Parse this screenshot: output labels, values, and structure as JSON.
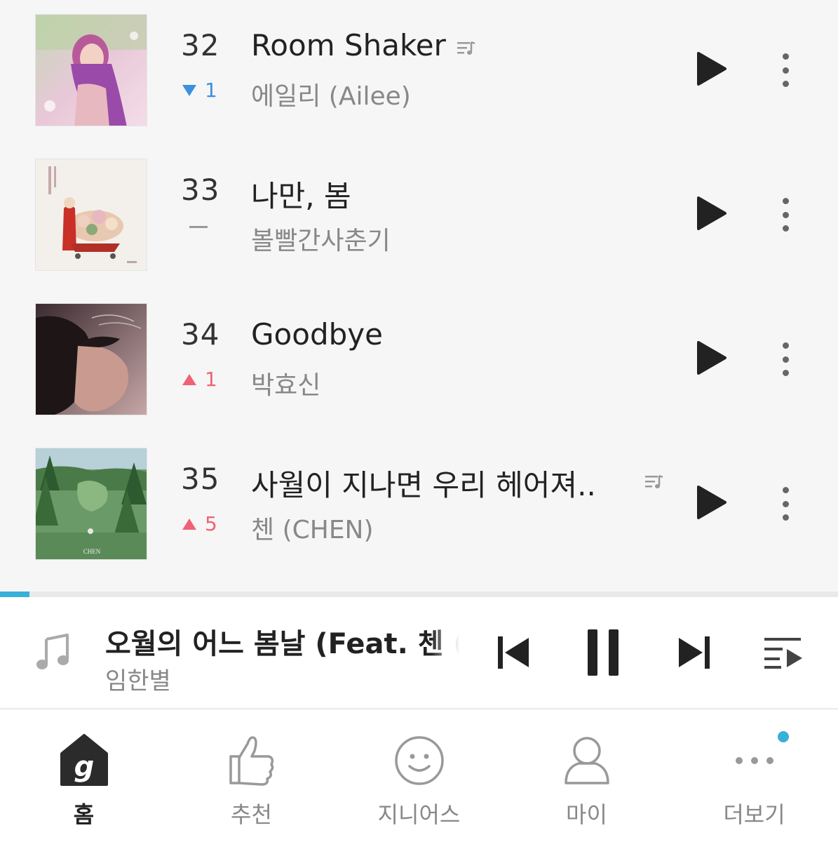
{
  "chart": {
    "rows": [
      {
        "rank": "32",
        "change_dir": "down",
        "change_value": "1",
        "title": "Room Shaker",
        "artist": "에일리 (Ailee)",
        "has_lyrics": true
      },
      {
        "rank": "33",
        "change_dir": "same",
        "change_value": "",
        "title": "나만, 봄",
        "artist": "볼빨간사춘기",
        "has_lyrics": false
      },
      {
        "rank": "34",
        "change_dir": "up",
        "change_value": "1",
        "title": "Goodbye",
        "artist": "박효신",
        "has_lyrics": false
      },
      {
        "rank": "35",
        "change_dir": "up",
        "change_value": "5",
        "title": "사월이 지나면 우리 헤어져..",
        "artist": "첸 (CHEN)",
        "has_lyrics": true
      }
    ],
    "cover_35_text": "CHEN"
  },
  "player": {
    "progress": 0.035,
    "track_title": "오월의 어느 봄날 (Feat. 첸 (CHEN))",
    "track_artist": "임한별"
  },
  "tabs": [
    {
      "label": "홈",
      "icon": "home-g-icon",
      "active": true
    },
    {
      "label": "추천",
      "icon": "thumbs-up-icon",
      "active": false
    },
    {
      "label": "지니어스",
      "icon": "smiley-icon",
      "active": false
    },
    {
      "label": "마이",
      "icon": "person-icon",
      "active": false
    },
    {
      "label": "더보기",
      "icon": "more-dots-icon",
      "active": false,
      "has_badge": true
    }
  ],
  "colors": {
    "accent": "#38b0d8",
    "rank_up": "#f06277",
    "rank_down": "#3d8fe0"
  }
}
